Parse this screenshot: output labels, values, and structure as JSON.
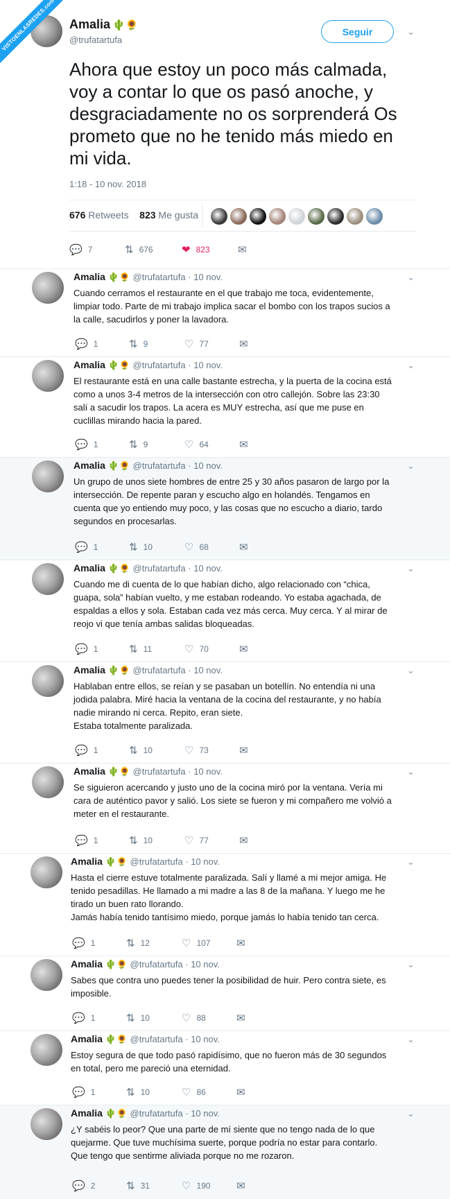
{
  "watermark": "VISTOENLASREDES.com",
  "main": {
    "name": "Amalia",
    "emojis": "🌵🌻",
    "handle": "@trufatartufa",
    "follow_label": "Seguir",
    "text": "Ahora que estoy un poco más calmada, voy a contar lo que os pasó anoche, y desgraciadamente no os sorprenderá Os prometo que no he tenido más miedo en mi vida.",
    "timestamp": "1:18 - 10 nov. 2018",
    "retweets_count": "676",
    "retweets_label": "Retweets",
    "likes_count": "823",
    "likes_label": "Me gusta",
    "likers": [
      "#3a3a3a",
      "#8a6a5a",
      "#111111",
      "#a58478",
      "#cfd4d8",
      "#5a6b4a",
      "#2c2c2c",
      "#9c8f7f",
      "#6a8ba8"
    ],
    "actions": {
      "replies": "7",
      "retweets": "676",
      "likes": "823"
    },
    "like_color": "#e0245e"
  },
  "replies": [
    {
      "name": "Amalia",
      "emojis": "🌵🌻",
      "handle": "@trufatartufa",
      "date": "· 10 nov.",
      "text": "Cuando cerramos el restaurante en el que trabajo me toca, evidentemente,\nlimpiar todo. Parte de mi trabajo implica sacar el bombo con los trapos sucios a\nla calle, sacudirlos y poner la lavadora.",
      "replies": "1",
      "retweets": "9",
      "likes": "77"
    },
    {
      "name": "Amalia",
      "emojis": "🌵🌻",
      "handle": "@trufatartufa",
      "date": "· 10 nov.",
      "text": "El restaurante está en una calle bastante estrecha, y la puerta de la cocina está\ncomo a unos 3-4 metros de la intersección con otro callejón. Sobre las 23:30\nsalí a sacudir los trapos. La acera es MUY estrecha, así que me puse en\ncuclillas mirando hacia la pared.",
      "replies": "1",
      "retweets": "9",
      "likes": "64"
    },
    {
      "name": "Amalia",
      "emojis": "🌵🌻",
      "handle": "@trufatartufa",
      "date": "· 10 nov.",
      "text": "Un grupo de unos siete hombres de entre 25 y 30 años pasaron de largo por la\nintersección. De repente paran y escucho algo en holandés. Tengamos en\ncuenta que yo entiendo muy poco, y las cosas que no escucho a diario, tardo\nsegundos en procesarlas.",
      "replies": "1",
      "retweets": "10",
      "likes": "68"
    },
    {
      "name": "Amalia",
      "emojis": "🌵🌻",
      "handle": "@trufatartufa",
      "date": "· 10 nov.",
      "text": "Cuando me di cuenta de lo que habían dicho, algo relacionado con “chica,\nguapa, sola” habían vuelto, y me estaban rodeando. Yo estaba agachada, de\nespaldas a ellos y sola. Estaban cada vez más cerca. Muy cerca. Y al mirar de\nreojo vi que tenía ambas salidas bloqueadas.",
      "replies": "1",
      "retweets": "11",
      "likes": "70"
    },
    {
      "name": "Amalia",
      "emojis": "🌵🌻",
      "handle": "@trufatartufa",
      "date": "· 10 nov.",
      "text": "Hablaban entre ellos, se reían y se pasaban un botellín. No entendía ni una\njodida palabra. Miré hacia la ventana de la cocina del restaurante, y no había\nnadie mirando ni cerca. Repito, eran siete.\nEstaba totalmente paralizada.",
      "replies": "1",
      "retweets": "10",
      "likes": "73"
    },
    {
      "name": "Amalia",
      "emojis": "🌵🌻",
      "handle": "@trufatartufa",
      "date": "· 10 nov.",
      "text": "Se siguieron acercando y justo uno de la cocina miró por la ventana. Vería mi\ncara de auténtico pavor y salió. Los siete se fueron y mi compañero me volvió a\nmeter en el restaurante.",
      "replies": "1",
      "retweets": "10",
      "likes": "77"
    },
    {
      "name": "Amalia",
      "emojis": "🌵🌻",
      "handle": "@trufatartufa",
      "date": "· 10 nov.",
      "text": "Hasta el cierre estuve totalmente paralizada. Salí y llamé a mi mejor amiga. He\ntenido pesadillas. He llamado a mi madre a las 8 de la mañana. Y luego me he\ntirado un buen rato llorando.\nJamás había tenido tantísimo miedo, porque jamás lo había tenido tan cerca.",
      "replies": "1",
      "retweets": "12",
      "likes": "107"
    },
    {
      "name": "Amalia",
      "emojis": "🌵🌻",
      "handle": "@trufatartufa",
      "date": "· 10 nov.",
      "text": "Sabes que contra uno puedes tener la posibilidad de huir. Pero contra siete, es\nimposible.",
      "replies": "1",
      "retweets": "10",
      "likes": "88"
    },
    {
      "name": "Amalia",
      "emojis": "🌵🌻",
      "handle": "@trufatartufa",
      "date": "· 10 nov.",
      "text": "Estoy segura de que todo pasó rapidísimo, que no fueron más de 30 segundos\nen total, pero me pareció una eternidad.",
      "replies": "1",
      "retweets": "10",
      "likes": "86"
    },
    {
      "name": "Amalia",
      "emojis": "🌵🌻",
      "handle": "@trufatartufa",
      "date": "· 10 nov.",
      "text": "¿Y sabéis lo peor? Que una parte de mí siente que no tengo nada de lo que\nquejarme. Que tuve muchísima suerte, porque podría no estar para contarlo.\nQue tengo que sentirme aliviada porque no me rozaron.",
      "replies": "2",
      "retweets": "31",
      "likes": "190"
    }
  ]
}
